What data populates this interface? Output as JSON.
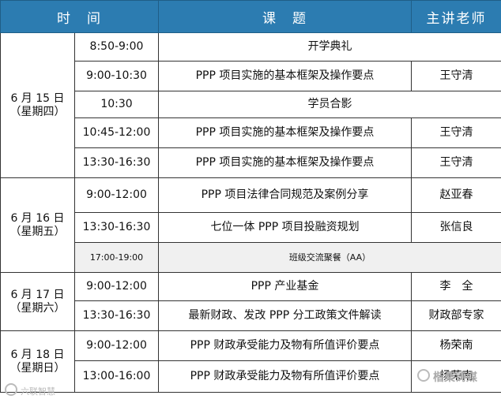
{
  "header": {
    "time": "时　间",
    "topic": "课　题",
    "teacher": "主讲老师"
  },
  "days": [
    {
      "date": "6 月 15 日",
      "weekday": "（星期四）"
    },
    {
      "date": "6 月 16 日",
      "weekday": "（星期五）"
    },
    {
      "date": "6 月 17 日",
      "weekday": "（星期六）"
    },
    {
      "date": "6 月 18 日",
      "weekday": "（星期日）"
    }
  ],
  "rows": [
    {
      "time": "8:50-9:00",
      "topic": "开学典礼"
    },
    {
      "time": "9:00-10:30",
      "topic": "PPP 项目实施的基本框架及操作要点",
      "teacher": "王守清"
    },
    {
      "time": "10:30",
      "topic": "学员合影"
    },
    {
      "time": "10:45-12:00",
      "topic": "PPP 项目实施的基本框架及操作要点",
      "teacher": "王守清"
    },
    {
      "time": "13:30-16:30",
      "topic": "PPP 项目实施的基本框架及操作要点",
      "teacher": "王守清"
    },
    {
      "time": "9:00-12:00",
      "topic": "PPP 项目法律合同规范及案例分享",
      "teacher": "赵亚春"
    },
    {
      "time": "13:30-16:30",
      "topic": "七位一体 PPP 项目投融资规划",
      "teacher": "张信良"
    },
    {
      "time": "17:00-19:00",
      "topic": "班级交流聚餐（AA）"
    },
    {
      "time": "9:00-12:00",
      "topic": "PPP 产业基金",
      "teacher": "李　全"
    },
    {
      "time": "13:30-16:30",
      "topic": "最新财政、发改 PPP 分工政策文件解读",
      "teacher": "财政部专家"
    },
    {
      "time": "9:00-12:00",
      "topic": "PPP 财政承受能力及物有所值评价要点",
      "teacher": "杨荣南"
    },
    {
      "time": "13:00-16:00",
      "topic": "PPP 财政承受能力及物有所值评价要点",
      "teacher": "杨荣南"
    }
  ],
  "watermarks": {
    "left": "六联智慧",
    "right": "楷桑铸媒"
  }
}
